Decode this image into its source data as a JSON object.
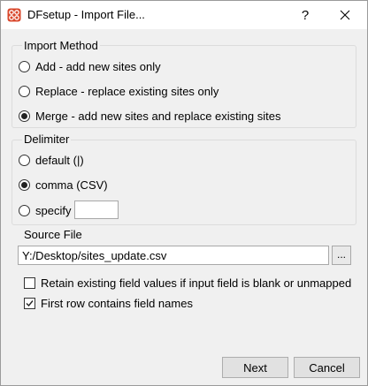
{
  "window": {
    "title": "DFsetup - Import File...",
    "help_label": "?",
    "close_label": "✕"
  },
  "import_method": {
    "label": "Import Method",
    "options": [
      {
        "label": "Add - add new sites only",
        "checked": false
      },
      {
        "label": "Replace - replace existing sites only",
        "checked": false
      },
      {
        "label": "Merge - add new sites and replace existing sites",
        "checked": true
      }
    ]
  },
  "delimiter": {
    "label": "Delimiter",
    "options": [
      {
        "label": "default (|)",
        "checked": false
      },
      {
        "label": "comma (CSV)",
        "checked": true
      },
      {
        "label": "specify",
        "checked": false
      }
    ],
    "specify_value": ""
  },
  "source_file": {
    "label": "Source File",
    "path": "Y:/Desktop/sites_update.csv",
    "browse_label": "..."
  },
  "options": {
    "retain_label": "Retain existing field values if input field is blank or unmapped",
    "retain_checked": false,
    "first_row_label": "First row contains field names",
    "first_row_checked": true
  },
  "buttons": {
    "next": "Next",
    "cancel": "Cancel"
  },
  "icons": {
    "app": "dfsetup-app-icon",
    "app_color": "#d9472b"
  }
}
